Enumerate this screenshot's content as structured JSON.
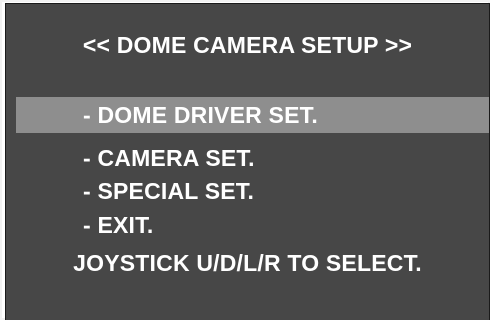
{
  "osd": {
    "title": "<< DOME CAMERA SETUP >>",
    "menu_items": [
      {
        "label": "- DOME DRIVER SET.",
        "selected": true
      },
      {
        "label": "- CAMERA SET.",
        "selected": false
      },
      {
        "label": "- SPECIAL SET.",
        "selected": false
      },
      {
        "label": "- EXIT.",
        "selected": false
      }
    ],
    "hint": "JOYSTICK U/D/L/R TO SELECT."
  },
  "colors": {
    "background": "#474747",
    "highlight": "#8e8e8e",
    "text": "#ffffff",
    "frame": "#f2f2f2"
  }
}
